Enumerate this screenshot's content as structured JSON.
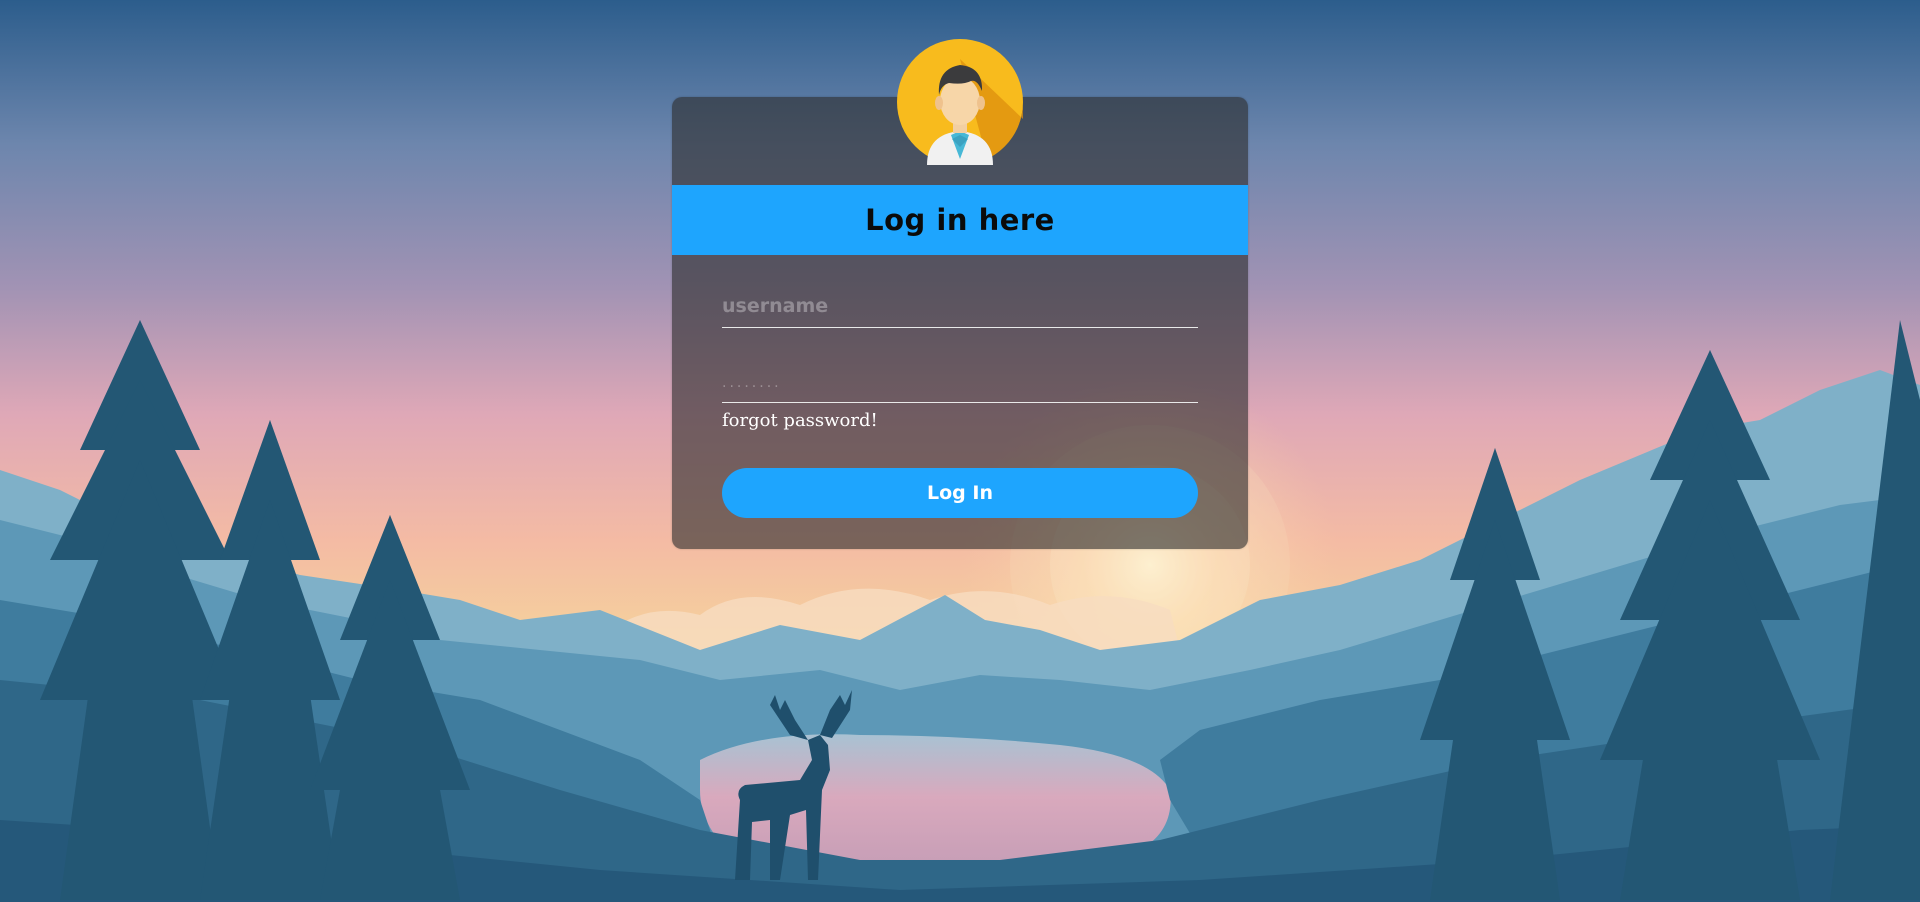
{
  "card": {
    "title": "Log in here"
  },
  "form": {
    "username_placeholder": "username",
    "username_value": "",
    "password_placeholder": "........",
    "password_value": "",
    "forgot_label": "forgot password!",
    "submit_label": "Log In"
  },
  "colors": {
    "accent": "#1ea5fe",
    "avatar_bg": "#f8bb1d"
  },
  "icons": {
    "avatar": "user-avatar-icon"
  }
}
